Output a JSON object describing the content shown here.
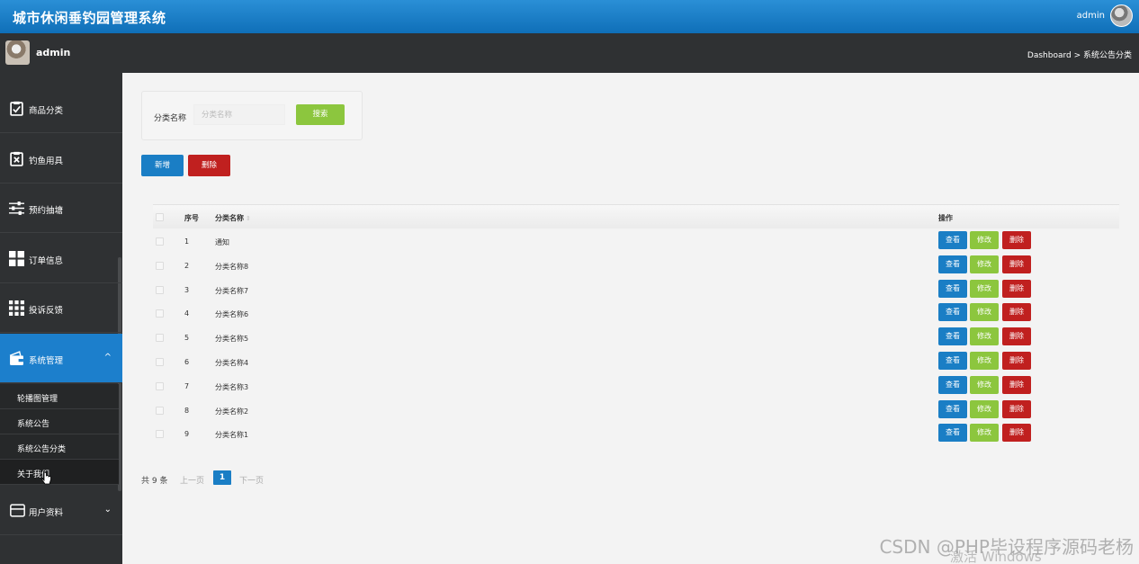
{
  "header": {
    "title": "城市休闲垂钓园管理系统",
    "user": "admin"
  },
  "subheader": {
    "user": "admin",
    "breadcrumb": "Dashboard > 系统公告分类"
  },
  "sidebar": {
    "items": [
      {
        "label": "商品分类",
        "icon": "clipboard-check-icon"
      },
      {
        "label": "钓鱼用具",
        "icon": "clipboard-x-icon"
      },
      {
        "label": "预约抽塘",
        "icon": "sliders-icon"
      },
      {
        "label": "订单信息",
        "icon": "grid-2x2-icon"
      },
      {
        "label": "投诉反馈",
        "icon": "grid-3x3-icon"
      },
      {
        "label": "系统管理",
        "icon": "wallet-icon",
        "chevron": "^"
      },
      {
        "label": "用户资料",
        "icon": "card-icon",
        "chevron": "⌄"
      }
    ],
    "subitems": [
      "轮播图管理",
      "系统公告",
      "系统公告分类",
      "关于我们"
    ]
  },
  "search": {
    "label": "分类名称",
    "placeholder": "分类名称",
    "button": "搜索"
  },
  "actions": {
    "add": "新增",
    "delete": "删除"
  },
  "table": {
    "headers": [
      "序号",
      "分类名称",
      "操作"
    ],
    "rows": [
      {
        "no": "1",
        "name": "通知"
      },
      {
        "no": "2",
        "name": "分类名称8"
      },
      {
        "no": "3",
        "name": "分类名称7"
      },
      {
        "no": "4",
        "name": "分类名称6"
      },
      {
        "no": "5",
        "name": "分类名称5"
      },
      {
        "no": "6",
        "name": "分类名称4"
      },
      {
        "no": "7",
        "name": "分类名称3"
      },
      {
        "no": "8",
        "name": "分类名称2"
      },
      {
        "no": "9",
        "name": "分类名称1"
      }
    ],
    "row_buttons": {
      "view": "查看",
      "edit": "修改",
      "delete": "删除"
    }
  },
  "pager": {
    "total": "共 9 条",
    "prev": "上一页",
    "current": "1",
    "next": "下一页"
  },
  "watermark": "CSDN @PHP毕设程序源码老杨",
  "activate": "激活 Windows",
  "colors": {
    "primary": "#1a7ec5",
    "success": "#8cc63e",
    "danger": "#c0201f",
    "sidebar": "#2f3133"
  }
}
